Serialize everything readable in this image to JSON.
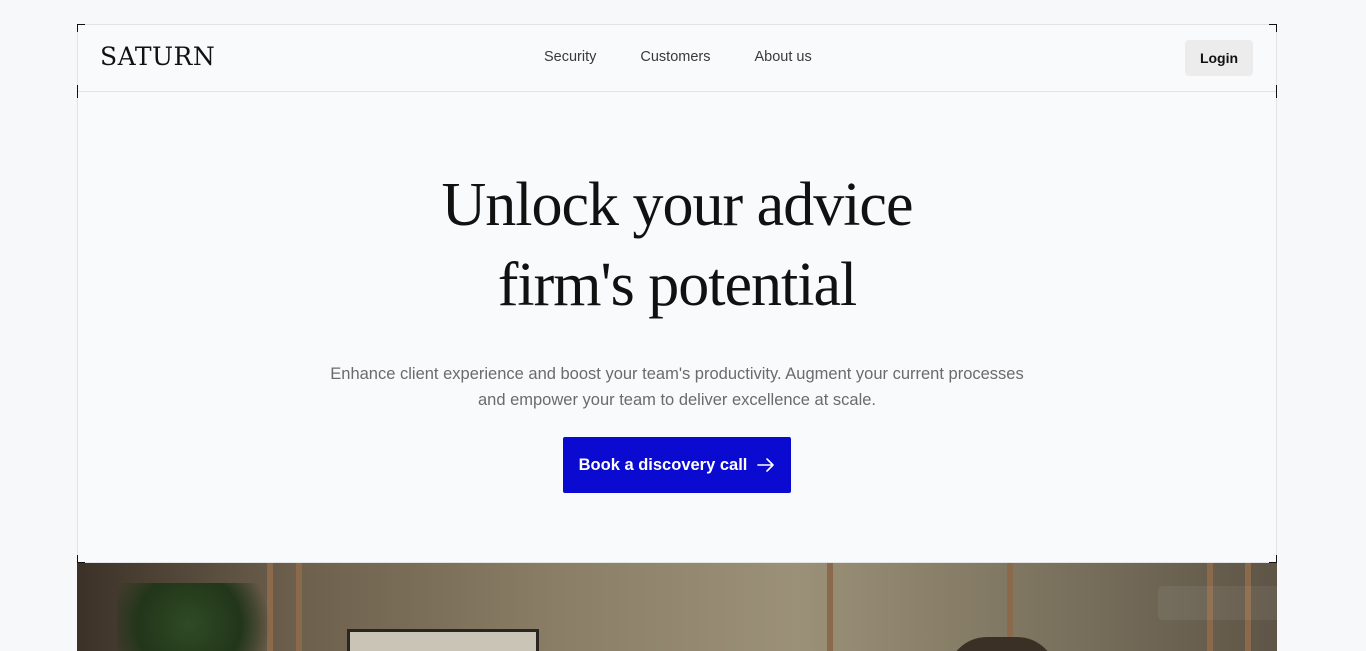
{
  "brand": {
    "name": "SATURN"
  },
  "nav": {
    "items": [
      {
        "label": "Security"
      },
      {
        "label": "Customers"
      },
      {
        "label": "About us"
      }
    ],
    "login_label": "Login"
  },
  "hero": {
    "headline_line1": "Unlock your advice",
    "headline_line2": "firm's potential",
    "subtitle_line1": "Enhance client experience and boost your team's productivity. Augment your current processes",
    "subtitle_line2": "and empower your team to deliver excellence at scale.",
    "cta_label": "Book a discovery call"
  },
  "colors": {
    "accent": "#0a0ad0",
    "background": "#f7f8f9",
    "login_bg": "#ececed"
  },
  "icons": {
    "cta": "arrow-right-icon"
  }
}
